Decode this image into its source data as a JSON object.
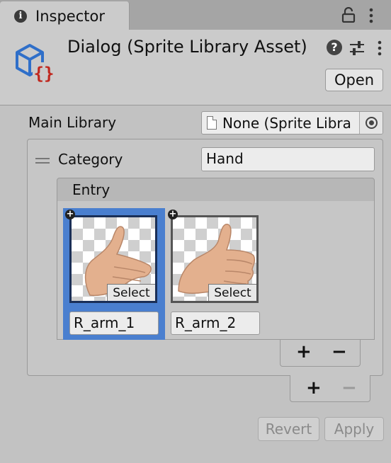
{
  "tab": {
    "title": "Inspector",
    "icon": "info-icon"
  },
  "header": {
    "title": "Dialog (Sprite Library Asset)",
    "open_label": "Open",
    "icons": [
      "sprite-library-asset-icon",
      "help-icon",
      "settings-sliders-icon",
      "more-options-icon"
    ]
  },
  "main_library": {
    "label": "Main Library",
    "value": "None (Sprite Libra"
  },
  "category": {
    "label": "Category",
    "value": "Hand"
  },
  "entry": {
    "label": "Entry",
    "sprites": [
      {
        "name": "R_arm_1",
        "select_label": "Select",
        "selected": true
      },
      {
        "name": "R_arm_2",
        "select_label": "Select",
        "selected": false
      }
    ]
  },
  "list_controls": {
    "add": "+",
    "remove": "−"
  },
  "actions": {
    "revert": "Revert",
    "apply": "Apply"
  },
  "colors": {
    "selection": "#4a7fcf",
    "asset_icon_blue": "#2f6fc9",
    "asset_icon_red": "#c0281f"
  }
}
